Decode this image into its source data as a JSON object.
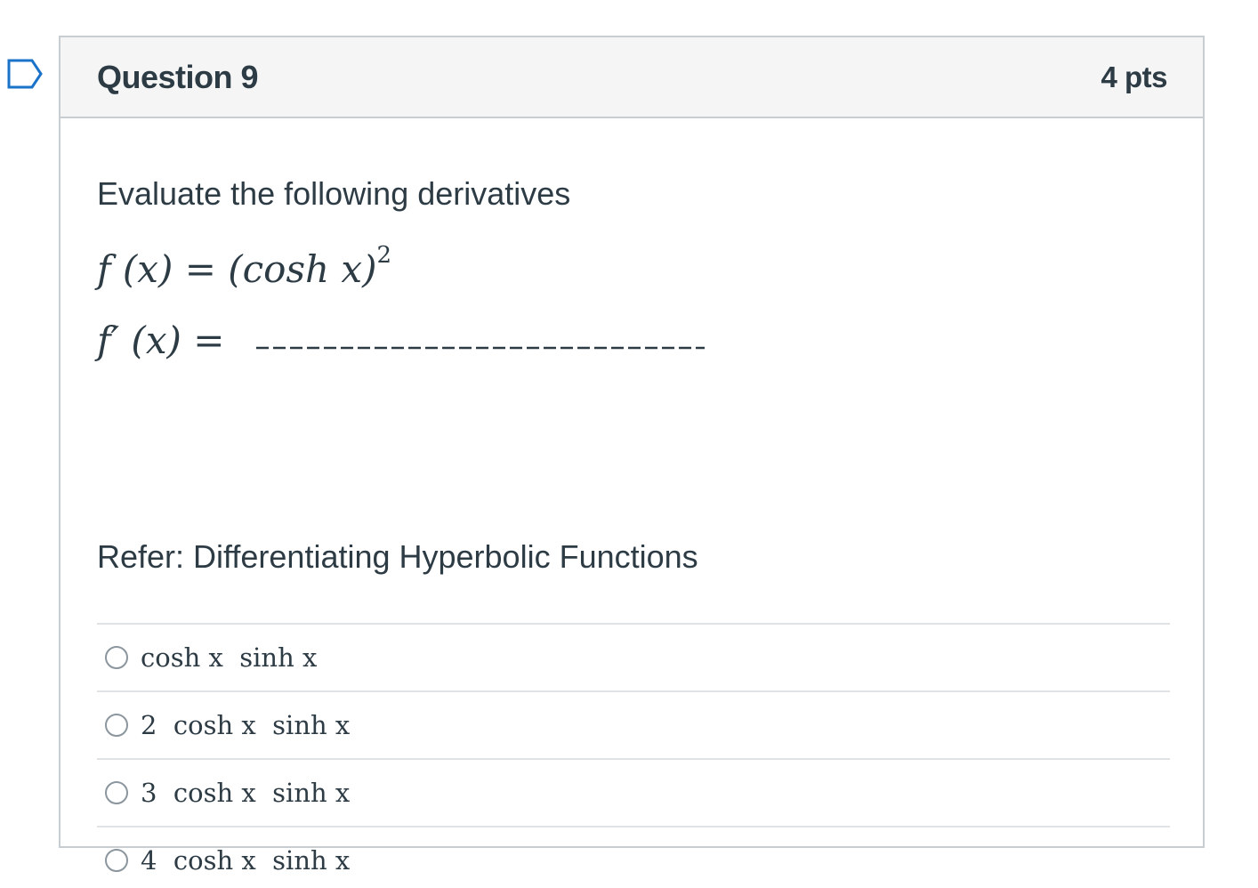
{
  "question": {
    "title": "Question 9",
    "points": "4 pts",
    "flag_icon": "bookmark-flag-icon",
    "prompt": "Evaluate the following derivatives",
    "equation_1": {
      "lhs": "f (x) = (cosh x)",
      "exponent": "2"
    },
    "equation_2": {
      "lhs": "f′ (x) ="
    },
    "refer": "Refer: Differentiating Hyperbolic Functions"
  },
  "answers": [
    {
      "label": "cosh x  sinh x",
      "selected": false
    },
    {
      "label": "2  cosh x  sinh x",
      "selected": false
    },
    {
      "label": "3  cosh x  sinh x",
      "selected": false
    },
    {
      "label": "4  cosh x  sinh x",
      "selected": false
    }
  ],
  "colors": {
    "text": "#2d3b45",
    "border": "#c7cdd1",
    "header_bg": "#f5f5f5",
    "flag": "#1a73c8"
  }
}
